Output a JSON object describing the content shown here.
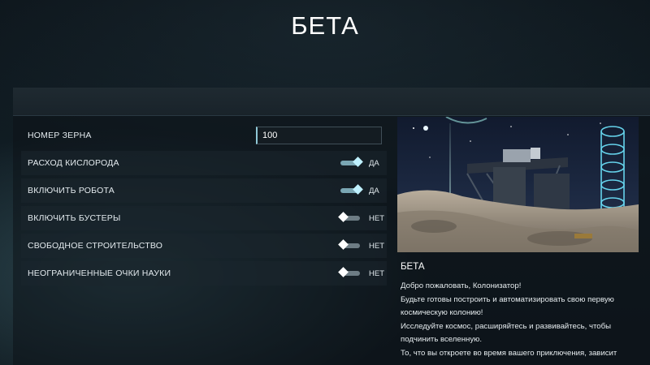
{
  "page": {
    "title": "БЕТА"
  },
  "settings": {
    "seed": {
      "label": "НОМЕР ЗЕРНА",
      "value": "100"
    },
    "toggles": [
      {
        "label": "РАСХОД КИСЛОРОДА",
        "state": "on",
        "value": "ДА"
      },
      {
        "label": "ВКЛЮЧИТЬ РОБОТА",
        "state": "on",
        "value": "ДА"
      },
      {
        "label": "ВКЛЮЧИТЬ БУСТЕРЫ",
        "state": "off",
        "value": "НЕТ"
      },
      {
        "label": "СВОБОДНОЕ СТРОИТЕЛЬСТВО",
        "state": "off",
        "value": "НЕТ"
      },
      {
        "label": "НЕОГРАНИЧЕННЫЕ ОЧКИ НАУКИ",
        "state": "off",
        "value": "НЕТ"
      }
    ]
  },
  "info": {
    "title": "БЕТА",
    "lines": [
      "Добро пожаловать, Колонизатор!",
      "Будьте готовы построить и автоматизировать свою первую",
      "космическую колонию!",
      "Исследуйте космос, расширяйтесь и развивайтесь, чтобы",
      "подчинить вселенную.",
      "То, что вы откроете во время вашего приключения, зависит"
    ]
  },
  "colors": {
    "accent": "#8fc7d6",
    "toggle_on": "#bff1ff",
    "toggle_off": "#ffffff"
  }
}
